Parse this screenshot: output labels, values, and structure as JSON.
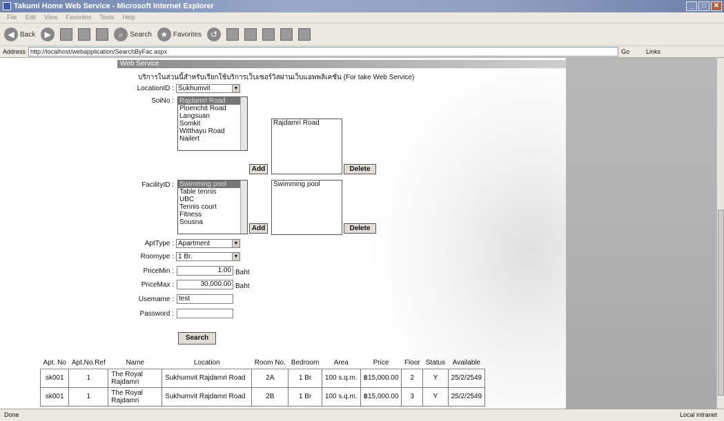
{
  "window": {
    "title": "Takumi Home Web Service - Microsoft Internet Explorer"
  },
  "menu": [
    "File",
    "Edit",
    "View",
    "Favorites",
    "Tools",
    "Help"
  ],
  "toolbar": {
    "back": "Back",
    "search": "Search",
    "favorites": "Favorites"
  },
  "address": {
    "label": "Address",
    "url": "http://localhost/webapplication/SearchByFac.aspx",
    "go": "Go",
    "links": "Links"
  },
  "page": {
    "header": "Web Service",
    "description": "บริการในส่วนนี้สำหรับเรียกใช้บริการเว็บเซอร์วิสผ่านเว็บแอพพลิเคชั่น (For take Web Service)",
    "location": {
      "label": "LocationID :",
      "value": "Sukhumvit"
    },
    "soi": {
      "label": "SoiNo :",
      "options": [
        "Rajdamri Road",
        "Ploenchit Road",
        "Langsuan",
        "Somkit",
        "Witthayu Road",
        "Nailert"
      ],
      "selected_list": [
        "Rajdamri Road"
      ],
      "add": "Add",
      "delete": "Delete"
    },
    "facility": {
      "label": "FacilityID :",
      "options": [
        "Swimming pool",
        "Table tennis",
        "UBC",
        "Tennis court",
        "Fitness",
        "Sousna"
      ],
      "selected_list": [
        "Swimming pool"
      ],
      "add": "Add",
      "delete": "Delete"
    },
    "apttype": {
      "label": "AptType :",
      "value": "Apartment"
    },
    "roomtype": {
      "label": "Roomype :",
      "value": "1 Br."
    },
    "pricemin": {
      "label": "PriceMin :",
      "value": "1.00",
      "unit": "Baht"
    },
    "pricemax": {
      "label": "PriceMax :",
      "value": "30,000.00",
      "unit": "Baht"
    },
    "username": {
      "label": "Usemame :",
      "value": "test"
    },
    "password": {
      "label": "Password :",
      "value": ""
    },
    "search": "Search"
  },
  "table": {
    "headers": [
      "Apt. No",
      "Apt.No.Ref",
      "Name",
      "Location",
      "Room No.",
      "Bedroom",
      "Area",
      "Price",
      "Floor",
      "Status",
      "Available"
    ],
    "rows": [
      [
        "sk001",
        "1",
        "The Royal Rajdamri",
        "Sukhumvit Rajdamri Road",
        "2A",
        "1 Br",
        "100 s.q.m.",
        "฿15,000.00",
        "2",
        "Y",
        "25/2/2549"
      ],
      [
        "sk001",
        "1",
        "The Royal Rajdamri",
        "Sukhumvit Rajdamri Road",
        "2B",
        "1 Br",
        "100 s.q.m.",
        "฿15,000.00",
        "3",
        "Y",
        "25/2/2549"
      ]
    ]
  },
  "status": {
    "left": "Done",
    "right": "Local intranet"
  }
}
